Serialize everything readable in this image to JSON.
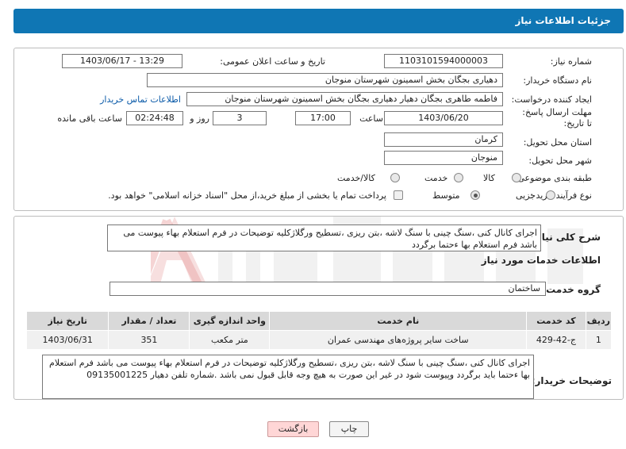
{
  "header": {
    "title": "جزئیات اطلاعات نیاز"
  },
  "form": {
    "need_number_label": "شماره نیاز:",
    "need_number": "1103101594000003",
    "announce_label": "تاریخ و ساعت اعلان عمومی:",
    "announce_value": "1403/06/17 - 13:29",
    "buyer_org_label": "نام دستگاه خریدار:",
    "buyer_org": "دهیاری بجگان بخش اسمینون شهرستان منوجان",
    "creator_label": "ایجاد کننده درخواست:",
    "creator": "فاطمه طاهری بجگان دهیار  دهیاری بجگان بخش اسمینون شهرستان منوجان",
    "contact_link": "اطلاعات تماس خریدار",
    "deadline_label": "مهلت ارسال پاسخ: تا تاریخ:",
    "deadline_date": "1403/06/20",
    "time_label": "ساعت",
    "deadline_time": "17:00",
    "days_value": "3",
    "days_label": "روز و",
    "remaining_time": "02:24:48",
    "remaining_label": "ساعت باقی مانده",
    "province_label": "استان محل تحویل:",
    "province": "کرمان",
    "city_label": "شهر محل تحویل:",
    "city": "منوجان",
    "category_label": "طبقه بندی موضوعی:",
    "category_options": [
      "کالا",
      "خدمت",
      "کالا/خدمت"
    ],
    "process_label": "نوع فرآیند خرید :",
    "process_options": [
      "جزیی",
      "متوسط"
    ],
    "payment_text": "پرداخت تمام یا بخشی از مبلغ خرید،از محل \"اسناد خزانه اسلامی\" خواهد بود."
  },
  "summary": {
    "label": "شرح کلی نیاز:",
    "text": "اجرای کانال کنی ،سنگ چینی با سنگ لاشه ،بتن ریزی ،تسطیح ورگلاژکلیه توضیحات در فرم استعلام بهاء پیوست می باشد فرم استعلام بها ءحتما  برگردد"
  },
  "services": {
    "section_title": "اطلاعات خدمات مورد نیاز",
    "group_label": "گروه خدمت:",
    "group_value": "ساختمان",
    "columns": [
      "ردیف",
      "کد خدمت",
      "نام خدمت",
      "واحد اندازه گیری",
      "تعداد / مقدار",
      "تاریخ نیاز"
    ],
    "rows": [
      [
        "1",
        "ج-42-429",
        "ساخت سایر پروژه‌های مهندسی عمران",
        "متر مکعب",
        "351",
        "1403/06/31"
      ]
    ]
  },
  "notes": {
    "label": "توضیحات خریدار:",
    "text": "اجرای کانال کنی ،سنگ چینی با سنگ لاشه ،بتن ریزی ،تسطیح ورگلاژکلیه توضیحات در فرم استعلام بهاء پیوست می باشد فرم استعلام بها ءحتما باید برگردد وپیوست شود در غیر این صورت به هیچ وجه قابل قبول نمی باشد .شماره تلفن دهیار 09135001225"
  },
  "buttons": {
    "print": "چاپ",
    "back": "بازگشت"
  },
  "colors": {
    "header": "#0f76b4",
    "back_button": "#ffd6d6"
  }
}
